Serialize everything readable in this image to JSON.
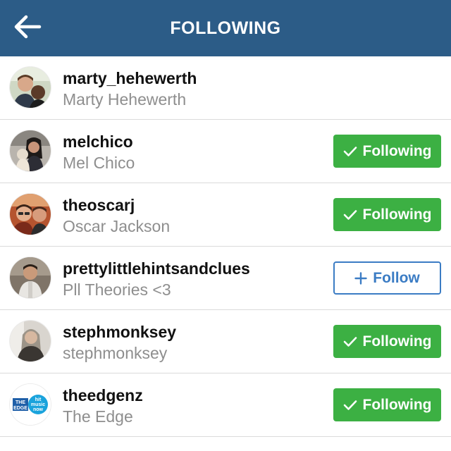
{
  "header": {
    "title": "FOLLOWING",
    "back_icon": "arrow-left-icon",
    "background_color": "#2c5c87"
  },
  "colors": {
    "following_button": "#3cb043",
    "follow_button": "#3b7cc4"
  },
  "users": [
    {
      "username": "marty_hehewerth",
      "full_name": "Marty Hehewerth",
      "button": null
    },
    {
      "username": "melchico",
      "full_name": "Mel Chico",
      "button": {
        "state": "following",
        "label": "Following",
        "icon": "checkmark-icon"
      }
    },
    {
      "username": "theoscarj",
      "full_name": "Oscar Jackson",
      "button": {
        "state": "following",
        "label": "Following",
        "icon": "checkmark-icon"
      }
    },
    {
      "username": "prettylittlehintsandclues",
      "full_name": "Pll Theories <3",
      "button": {
        "state": "follow",
        "label": "Follow",
        "icon": "plus-icon"
      }
    },
    {
      "username": "stephmonksey",
      "full_name": "stephmonksey",
      "button": {
        "state": "following",
        "label": "Following",
        "icon": "checkmark-icon"
      }
    },
    {
      "username": "theedgenz",
      "full_name": "The Edge",
      "button": {
        "state": "following",
        "label": "Following",
        "icon": "checkmark-icon"
      }
    }
  ],
  "avatar_logo": {
    "line1": "THE",
    "line2": "EDGE",
    "line3": "hit",
    "line4": "music",
    "line5": "now"
  }
}
